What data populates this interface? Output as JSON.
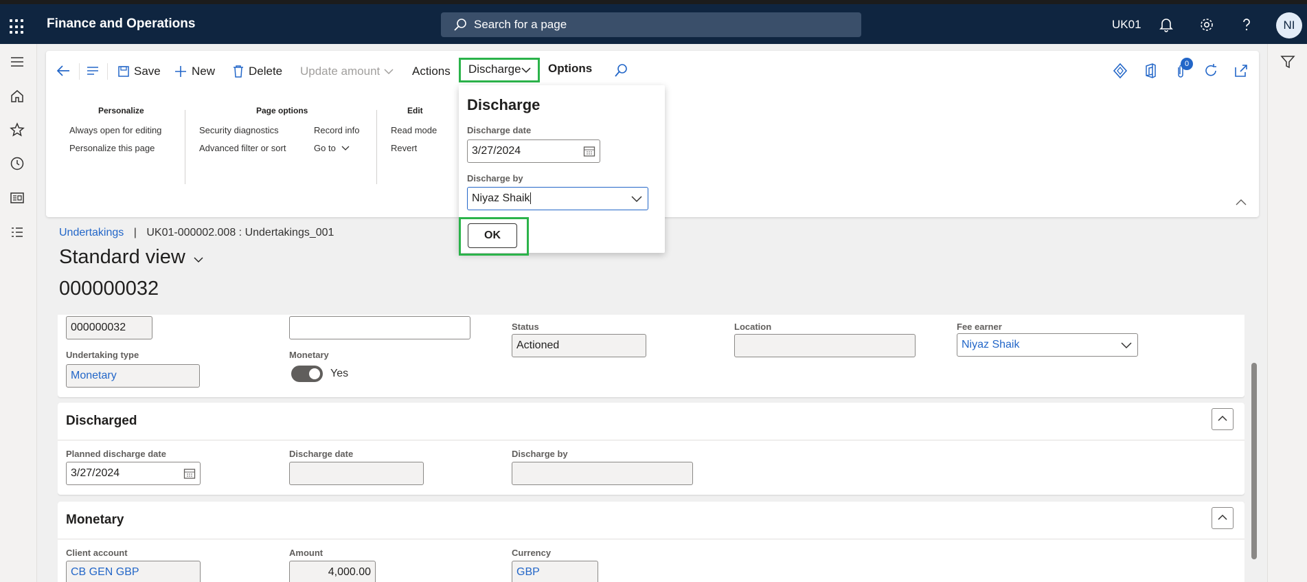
{
  "topbar": {
    "app_name": "Finance and Operations",
    "search_placeholder": "Search for a page",
    "company": "UK01",
    "avatar_initials": "NI"
  },
  "actionpane": {
    "save": "Save",
    "new": "New",
    "delete": "Delete",
    "update_amount": "Update amount",
    "actions": "Actions",
    "discharge": "Discharge",
    "options": "Options",
    "attachments_count": "0",
    "groups": {
      "personalize": {
        "title": "Personalize",
        "items": [
          "Always open for editing",
          "Personalize this page"
        ]
      },
      "page_options": {
        "title": "Page options",
        "items": [
          "Security diagnostics",
          "Advanced filter or sort",
          "Record info",
          "Go to"
        ]
      },
      "edit": {
        "title": "Edit",
        "items": [
          "Read mode",
          "Revert"
        ]
      }
    }
  },
  "flyout": {
    "title": "Discharge",
    "discharge_date_label": "Discharge date",
    "discharge_date_value": "3/27/2024",
    "discharge_by_label": "Discharge by",
    "discharge_by_value": "Niyaz Shaik",
    "ok_label": "OK"
  },
  "header": {
    "breadcrumb_link": "Undertakings",
    "breadcrumb_sep": "|",
    "breadcrumb_record": "UK01-000002.008 : Undertakings_001",
    "view_name": "Standard view",
    "record_id": "000000032"
  },
  "general": {
    "id_value": "000000032",
    "second_value": "",
    "status_label": "Status",
    "status_value": "Actioned",
    "location_label": "Location",
    "location_value": "",
    "fee_earner_label": "Fee earner",
    "fee_earner_value": "Niyaz Shaik",
    "undertaking_type_label": "Undertaking type",
    "undertaking_type_value": "Monetary",
    "monetary_label": "Monetary",
    "monetary_value": "Yes"
  },
  "discharged": {
    "title": "Discharged",
    "planned_label": "Planned discharge date",
    "planned_value": "3/27/2024",
    "date_label": "Discharge date",
    "date_value": "",
    "by_label": "Discharge by",
    "by_value": ""
  },
  "monetary": {
    "title": "Monetary",
    "client_account_label": "Client account",
    "client_account_value": "CB GEN GBP",
    "amount_label": "Amount",
    "amount_value": "4,000.00",
    "currency_label": "Currency",
    "currency_value": "GBP"
  },
  "colors": {
    "nav": "#0f2540",
    "accent": "#2266c8",
    "highlight": "#2bb34a"
  }
}
